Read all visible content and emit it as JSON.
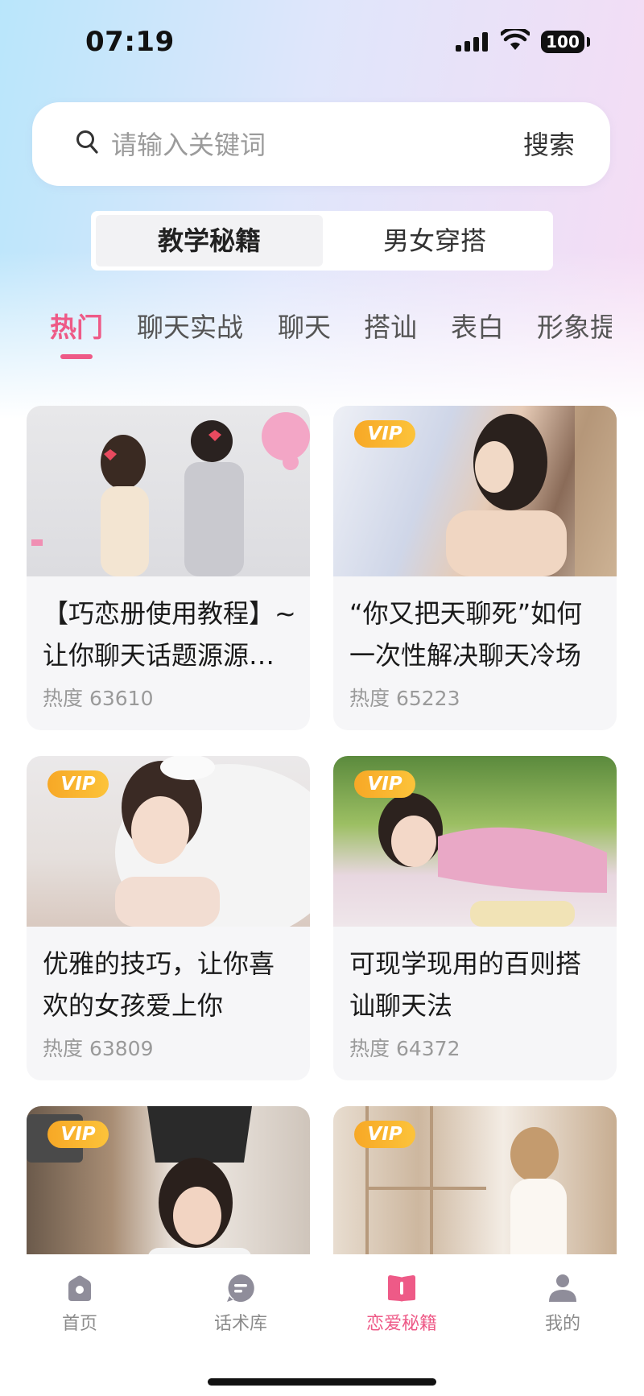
{
  "status_bar": {
    "time": "07:19",
    "battery": "100"
  },
  "search": {
    "placeholder": "请输入关键词",
    "button_label": "搜索"
  },
  "segment": {
    "items": [
      "教学秘籍",
      "男女穿搭"
    ],
    "active_index": 0
  },
  "categories": {
    "items": [
      "热门",
      "聊天实战",
      "聊天",
      "搭讪",
      "表白",
      "形象提"
    ],
    "active_index": 0
  },
  "cards": [
    {
      "title": "【巧恋册使用教程】~让你聊天话题源源不断",
      "heat": "热度 63610",
      "vip": ""
    },
    {
      "title": "“你又把天聊死”如何一次性解决聊天冷场",
      "heat": "热度 65223",
      "vip": "VIP"
    },
    {
      "title": "优雅的技巧，让你喜欢的女孩爱上你",
      "heat": "热度 63809",
      "vip": "VIP"
    },
    {
      "title": "可现学现用的百则搭讪聊天法",
      "heat": "热度 64372",
      "vip": "VIP"
    },
    {
      "title": "",
      "heat": "",
      "vip": "VIP"
    },
    {
      "title": "",
      "heat": "",
      "vip": "VIP"
    }
  ],
  "tabbar": {
    "items": [
      {
        "label": "首页",
        "icon": "home-icon"
      },
      {
        "label": "话术库",
        "icon": "chat-bubble-icon"
      },
      {
        "label": "恋爱秘籍",
        "icon": "book-icon"
      },
      {
        "label": "我的",
        "icon": "person-icon"
      }
    ],
    "active_index": 2
  },
  "colors": {
    "accent": "#ee5a87",
    "vip": "#f7a826",
    "tab_inactive": "#8b8b8b"
  }
}
